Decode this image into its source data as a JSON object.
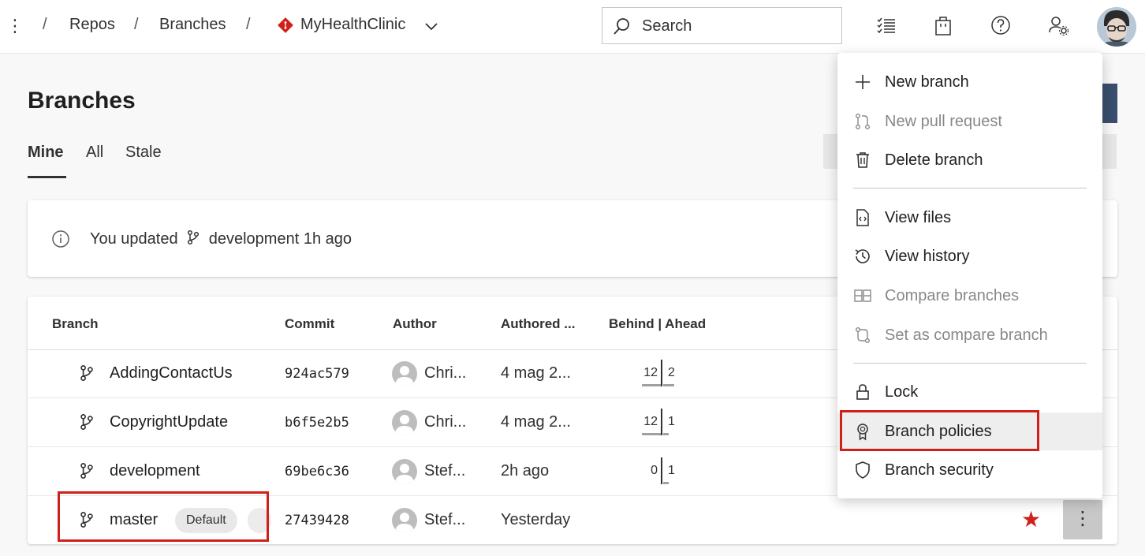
{
  "topbar": {
    "breadcrumb_sep": "/",
    "crumb_repos": "Repos",
    "crumb_branches": "Branches",
    "repo_name": "MyHealthClinic",
    "search_placeholder": "Search"
  },
  "page": {
    "title": "Branches",
    "tabs": [
      {
        "label": "Mine",
        "active": true
      },
      {
        "label": "All",
        "active": false
      },
      {
        "label": "Stale",
        "active": false
      }
    ]
  },
  "info": {
    "prefix": "You updated",
    "branch": "development",
    "suffix": "1h ago"
  },
  "table": {
    "headers": {
      "branch": "Branch",
      "commit": "Commit",
      "author": "Author",
      "authored": "Authored ...",
      "behind_ahead": "Behind | Ahead"
    },
    "rows": [
      {
        "branch": "AddingContactUs",
        "commit": "924ac579",
        "author": "Chri...",
        "authored": "4 mag 2...",
        "behind": "12",
        "ahead": "2"
      },
      {
        "branch": "CopyrightUpdate",
        "commit": "b6f5e2b5",
        "author": "Chri...",
        "authored": "4 mag 2...",
        "behind": "12",
        "ahead": "1"
      },
      {
        "branch": "development",
        "commit": "69be6c36",
        "author": "Stef...",
        "authored": "2h ago",
        "behind": "0",
        "ahead": "1"
      },
      {
        "branch": "master",
        "badge": "Default",
        "commit": "27439428",
        "author": "Stef...",
        "authored": "Yesterday",
        "favorite": true
      }
    ]
  },
  "menu": {
    "items": [
      {
        "label": "New branch",
        "icon": "plus-icon",
        "disabled": false
      },
      {
        "label": "New pull request",
        "icon": "pull-request-icon",
        "disabled": true
      },
      {
        "label": "Delete branch",
        "icon": "trash-icon",
        "disabled": false
      },
      {
        "label": "View files",
        "icon": "file-code-icon",
        "disabled": false
      },
      {
        "label": "View history",
        "icon": "history-icon",
        "disabled": false
      },
      {
        "label": "Compare branches",
        "icon": "compare-icon",
        "disabled": true
      },
      {
        "label": "Set as compare branch",
        "icon": "compare-branch-icon",
        "disabled": true
      },
      {
        "label": "Lock",
        "icon": "lock-icon",
        "disabled": false
      },
      {
        "label": "Branch policies",
        "icon": "ribbon-icon",
        "disabled": false
      },
      {
        "label": "Branch security",
        "icon": "shield-icon",
        "disabled": false
      }
    ]
  },
  "colors": {
    "highlight": "#d0201a",
    "repo_icon": "#d0201a",
    "favorite_star": "#d0201a",
    "disabled_text": "#8a8886"
  }
}
